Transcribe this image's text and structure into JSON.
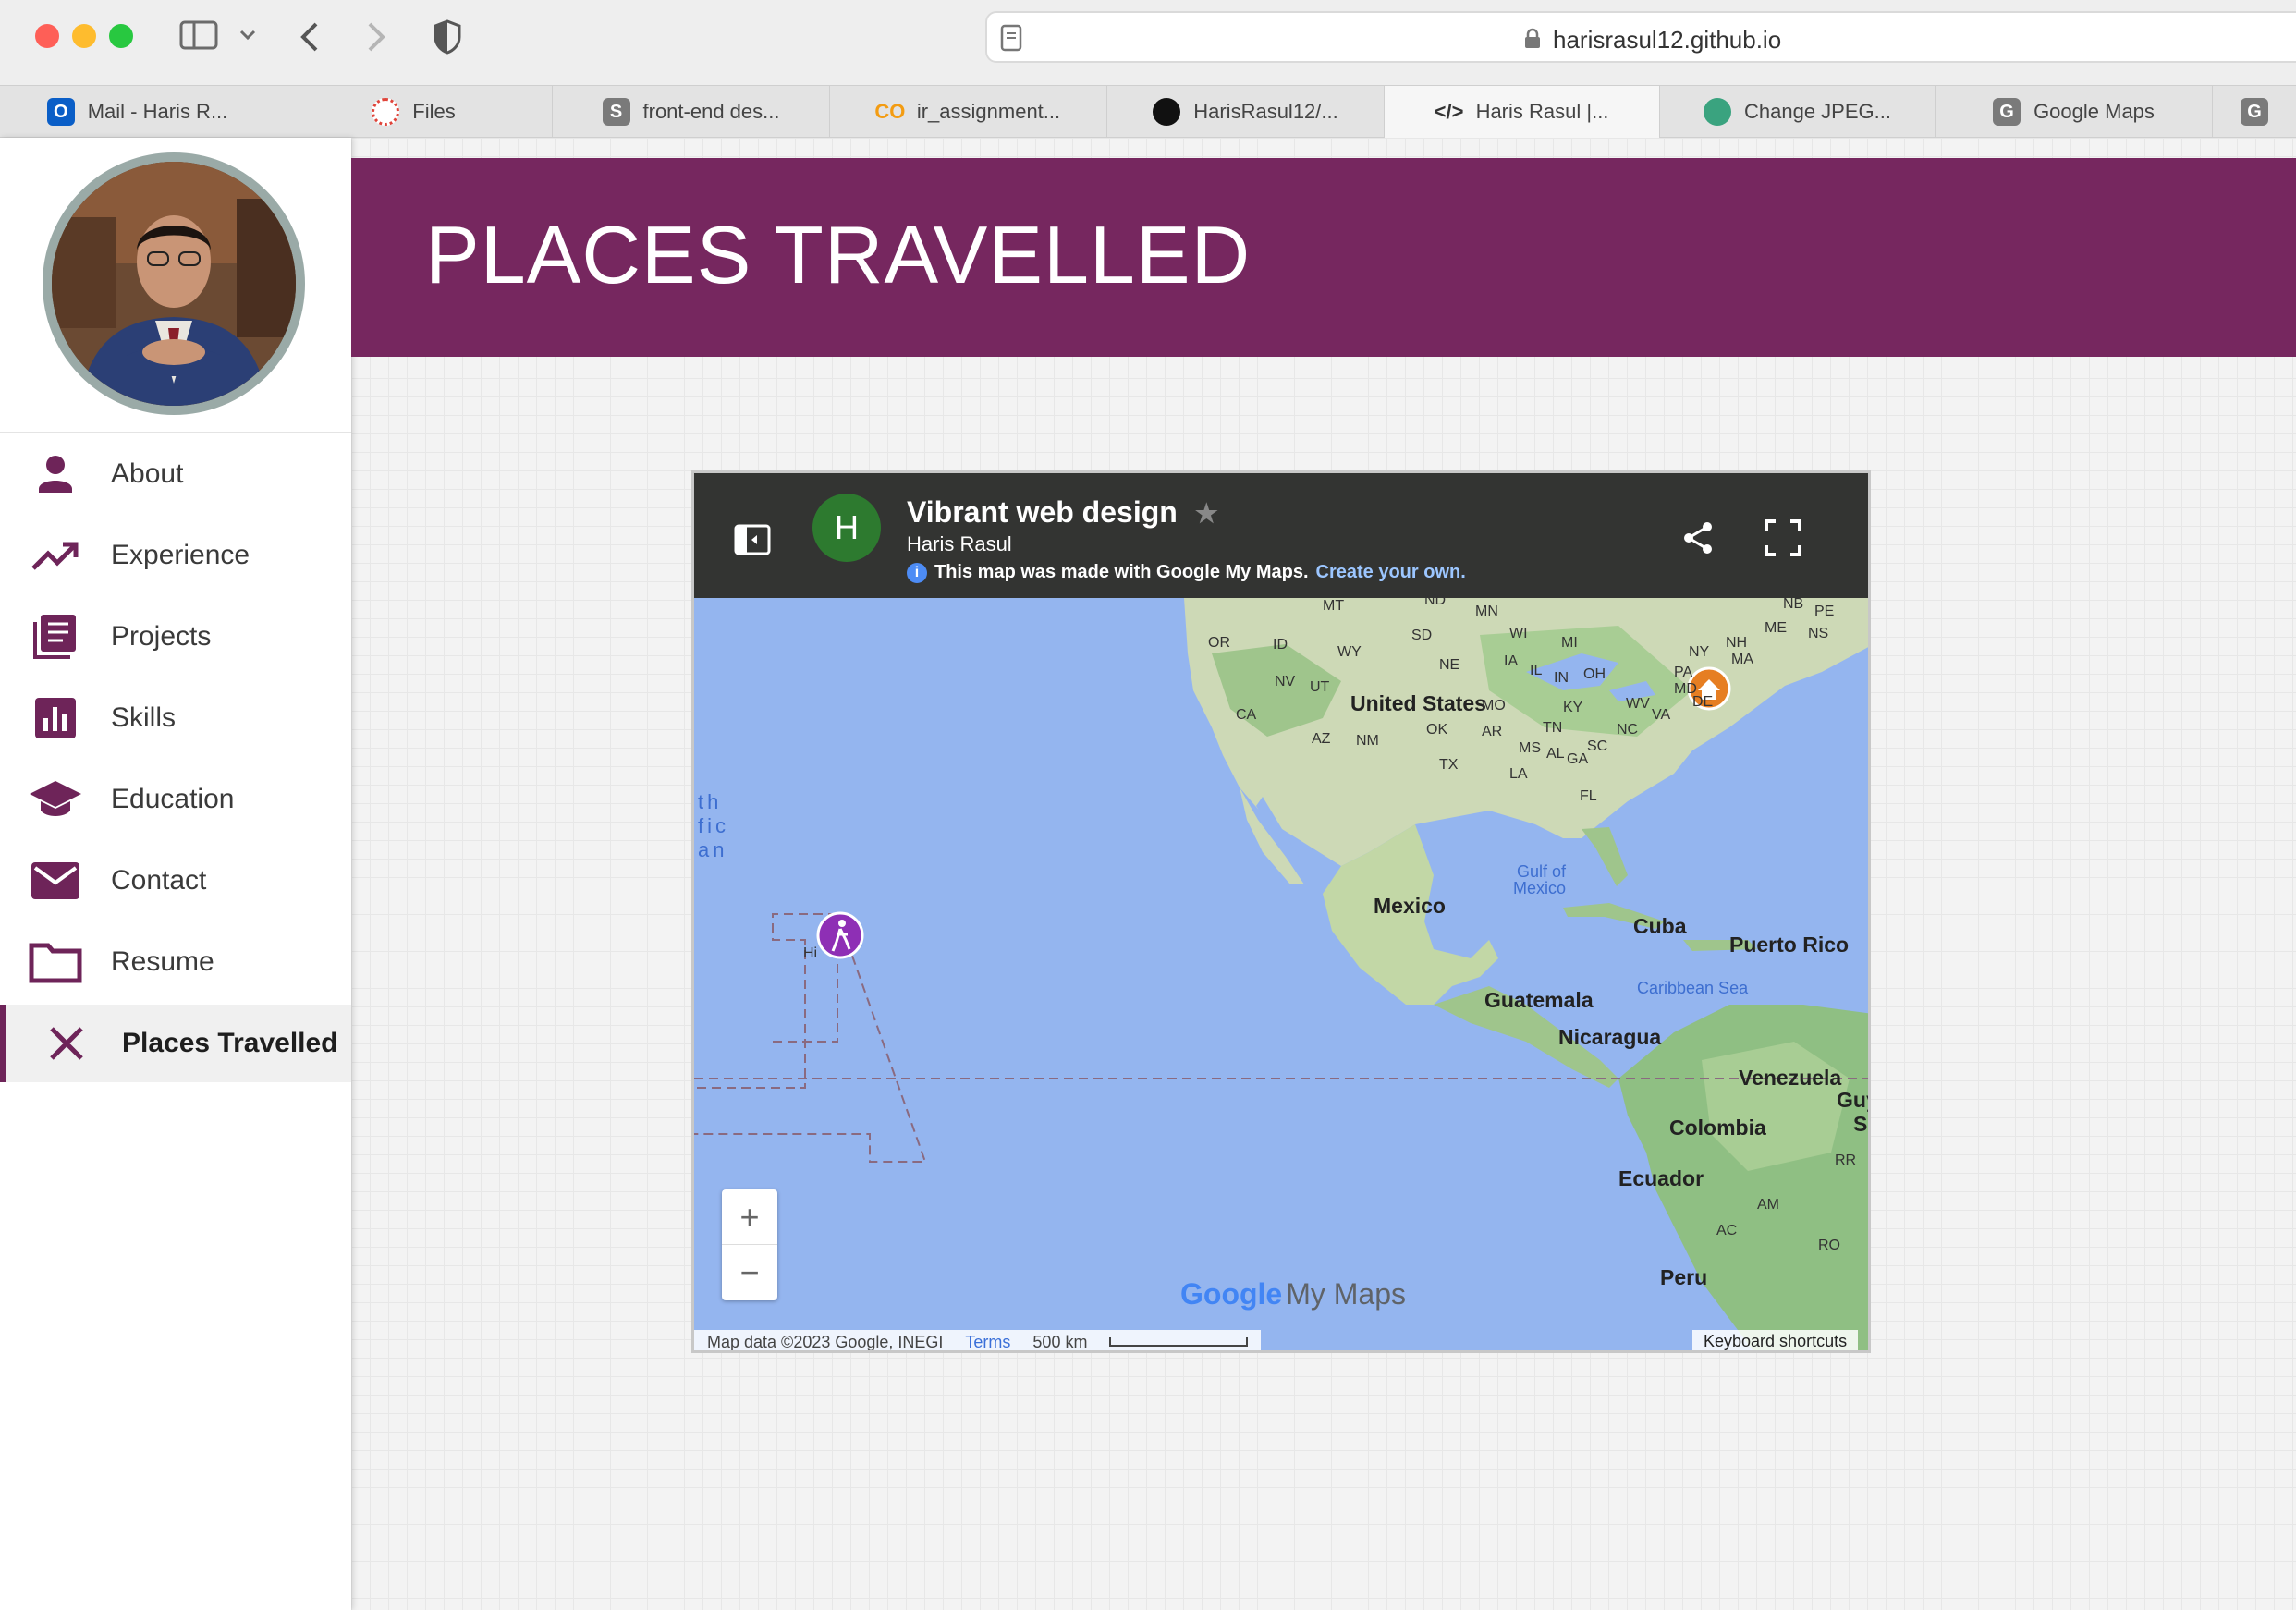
{
  "browser": {
    "url": "harisrasul12.github.io",
    "tabs": [
      {
        "label": "Mail - Haris R...",
        "icon": "outlook-icon",
        "color": "#0a5ec7"
      },
      {
        "label": "Files",
        "icon": "files-icon",
        "color": "#e0443a"
      },
      {
        "label": "front-end des...",
        "icon": "s-icon",
        "color": "#7a7a7a"
      },
      {
        "label": "ir_assignment...",
        "icon": "colab-icon",
        "color": "#f39c12"
      },
      {
        "label": "HarisRasul12/...",
        "icon": "github-icon",
        "color": "#111111"
      },
      {
        "label": "Haris Rasul |...",
        "icon": "code-icon",
        "color": "#333333"
      },
      {
        "label": "Change JPEG...",
        "icon": "chatgpt-icon",
        "color": "#3aa37f"
      },
      {
        "label": "Google Maps",
        "icon": "g-icon",
        "color": "#7a7a7a"
      },
      {
        "label": "",
        "icon": "g-icon",
        "color": "#7a7a7a"
      }
    ],
    "active_tab": 5
  },
  "sidebar": {
    "items": [
      {
        "label": "About",
        "icon": "person-icon"
      },
      {
        "label": "Experience",
        "icon": "trending-up-icon"
      },
      {
        "label": "Projects",
        "icon": "list-icon"
      },
      {
        "label": "Skills",
        "icon": "bar-chart-icon"
      },
      {
        "label": "Education",
        "icon": "graduation-cap-icon"
      },
      {
        "label": "Contact",
        "icon": "mail-icon"
      },
      {
        "label": "Resume",
        "icon": "folder-icon"
      },
      {
        "label": "Places Travelled",
        "icon": "close-icon"
      }
    ],
    "active_item": 7,
    "accent_color": "#6e2459"
  },
  "banner": {
    "title": "PLACES TRAVELLED",
    "color": "#76275f"
  },
  "map": {
    "avatar_letter": "H",
    "title": "Vibrant web design",
    "owner": "Haris Rasul",
    "note": "This map was made with Google My Maps.",
    "note_link": "Create your own.",
    "labels": {
      "countries": [
        "United States",
        "Mexico",
        "Cuba",
        "Puerto Rico",
        "Guatemala",
        "Nicaragua",
        "Venezuela",
        "Colombia",
        "Ecuador",
        "Peru",
        "Guy",
        "S"
      ],
      "states": [
        "MT",
        "ND",
        "MN",
        "NB",
        "PE",
        "ME",
        "NS",
        "OR",
        "ID",
        "SD",
        "WI",
        "MI",
        "NH",
        "MA",
        "NY",
        "WY",
        "NE",
        "IA",
        "PA",
        "NV",
        "UT",
        "IL",
        "IN",
        "OH",
        "MD",
        "DE",
        "CA",
        "MO",
        "KY",
        "WV",
        "VA",
        "AZ",
        "NM",
        "OK",
        "AR",
        "TN",
        "NC",
        "MS",
        "AL",
        "SC",
        "GA",
        "TX",
        "LA",
        "FL",
        "RR",
        "AM",
        "AC",
        "RO",
        "Hi"
      ],
      "water": [
        "Gulf of",
        "Mexico",
        "Caribbean Sea",
        "th",
        "fic",
        "an"
      ]
    },
    "zoom_in": "+",
    "zoom_out": "−",
    "attribution": "Map data ©2023 Google, INEGI",
    "terms": "Terms",
    "scale": "500 km",
    "keyboard": "Keyboard shortcuts",
    "logo_google": "Google",
    "logo_mymaps": "My Maps",
    "pins": [
      {
        "name": "home-pin",
        "color": "#e67e22",
        "icon": "home-icon"
      },
      {
        "name": "hike-pin",
        "color": "#8e2fb5",
        "icon": "hiker-icon"
      }
    ]
  }
}
